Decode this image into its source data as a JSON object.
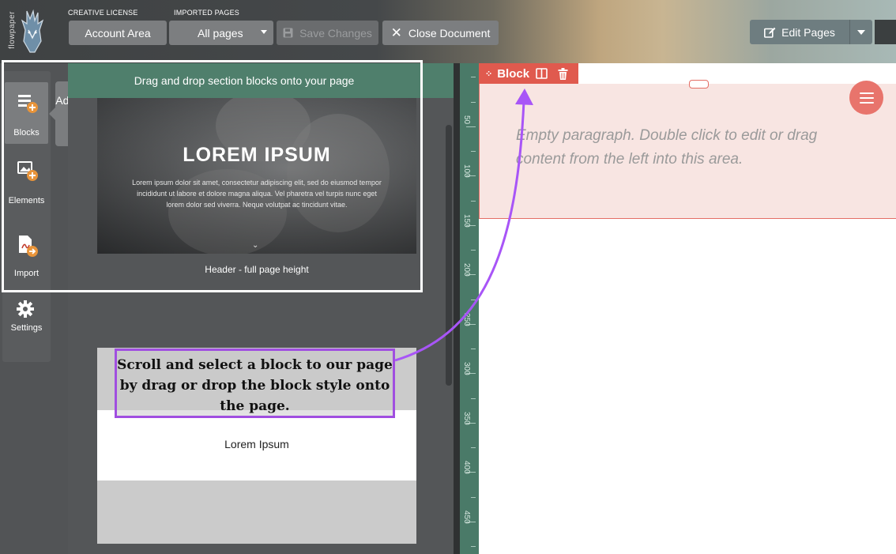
{
  "app": {
    "logo_text": "flowpaper"
  },
  "toolbar": {
    "license_label": "CREATIVE LICENSE",
    "imported_label": "IMPORTED PAGES",
    "account_button": "Account Area",
    "pages_select": "All pages",
    "save_button": "Save Changes",
    "close_button": "Close Document",
    "edit_button": "Edit Pages"
  },
  "sidebar": {
    "items": [
      {
        "label": "Blocks",
        "icon": "blocks-icon",
        "active": true
      },
      {
        "label": "Elements",
        "icon": "elements-icon"
      },
      {
        "label": "Import",
        "icon": "import-icon"
      },
      {
        "label": "Settings",
        "icon": "gear-icon"
      }
    ],
    "tooltip": "Add Section Block"
  },
  "panel": {
    "header": "Drag and drop section blocks onto your page",
    "blocks": [
      {
        "title": "LOREM IPSUM",
        "body": "Lorem ipsum dolor sit amet, consectetur adipiscing elit, sed do eiusmod tempor incididunt ut labore et dolore magna aliqua. Vel pharetra vel turpis nunc eget lorem dolor sed viverra. Neque volutpat ac tincidunt vitae.",
        "caption": "Header - full page height"
      },
      {
        "title": "Lorem Ipsum"
      }
    ]
  },
  "annotation": {
    "callout": "Scroll and select a block to our page by drag or drop the block style onto the page.",
    "color": "#a04ee0"
  },
  "ruler": {
    "marks": [
      "50",
      "100",
      "150",
      "200",
      "250",
      "300",
      "350",
      "400",
      "450"
    ]
  },
  "canvas": {
    "block_label": "Block",
    "placeholder": "Empty paragraph. Double click to edit or drag content from the left into this area.",
    "accent": "#e05a4e"
  }
}
